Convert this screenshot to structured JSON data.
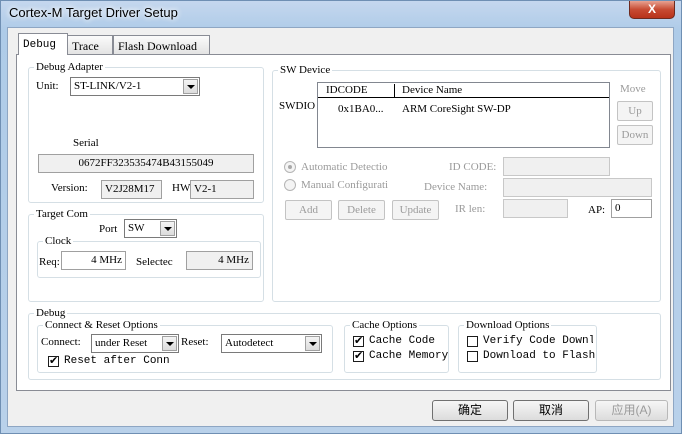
{
  "window": {
    "title": "Cortex-M Target Driver Setup",
    "close_glyph": "X"
  },
  "tabs": [
    {
      "label": "Debug",
      "active": true
    },
    {
      "label": "Trace",
      "active": false
    },
    {
      "label": "Flash Download",
      "active": false
    }
  ],
  "debug_adapter": {
    "group_label": "Debug Adapter",
    "unit_label": "Unit:",
    "unit_value": "ST-LINK/V2-1",
    "serial_label": "Serial",
    "serial_value": "0672FF323535474B43155049",
    "version_label": "Version:",
    "version_value": "V2J28M17",
    "hw_label": "HW:",
    "hw_value": "V2-1"
  },
  "target_com": {
    "group_label": "Target Com",
    "port_label": "Port",
    "port_value": "SW",
    "clock": {
      "group_label": "Clock",
      "req_label": "Req:",
      "req_value": "4 MHz",
      "selected_label": "Selectec",
      "selected_value": "4 MHz"
    }
  },
  "sw_device": {
    "group_label": "SW Device",
    "swdio_label": "SWDIO",
    "columns": [
      "IDCODE",
      "Device Name"
    ],
    "rows": [
      {
        "idcode": "0x1BA0...",
        "device_name": "ARM CoreSight SW-DP"
      }
    ],
    "move_label": "Move",
    "up_label": "Up",
    "down_label": "Down",
    "automatic_label": "Automatic Detectio",
    "manual_label": "Manual Configurati",
    "id_code_label": "ID CODE:",
    "device_name_label": "Device Name:",
    "add_label": "Add",
    "delete_label": "Delete",
    "update_label": "Update",
    "ir_len_label": "IR len:",
    "ap_label": "AP:",
    "ap_value": "0"
  },
  "debug": {
    "group_label": "Debug",
    "connect_reset": {
      "group_label": "Connect & Reset Options",
      "connect_label": "Connect:",
      "connect_value": "under Reset",
      "reset_label": "Reset:",
      "reset_value": "Autodetect",
      "reset_after_conn_label": "Reset after Conn",
      "reset_after_conn_checked": true
    },
    "cache": {
      "group_label": "Cache Options",
      "cache_code_label": "Cache Code",
      "cache_code_checked": true,
      "cache_memory_label": "Cache Memory",
      "cache_memory_checked": true
    },
    "download": {
      "group_label": "Download Options",
      "verify_label": "Verify Code Downlo",
      "verify_checked": false,
      "download_flash_label": "Download to Flash",
      "download_flash_checked": false
    }
  },
  "footer": {
    "ok_label": "确定",
    "cancel_label": "取消",
    "apply_label": "应用(A)"
  }
}
